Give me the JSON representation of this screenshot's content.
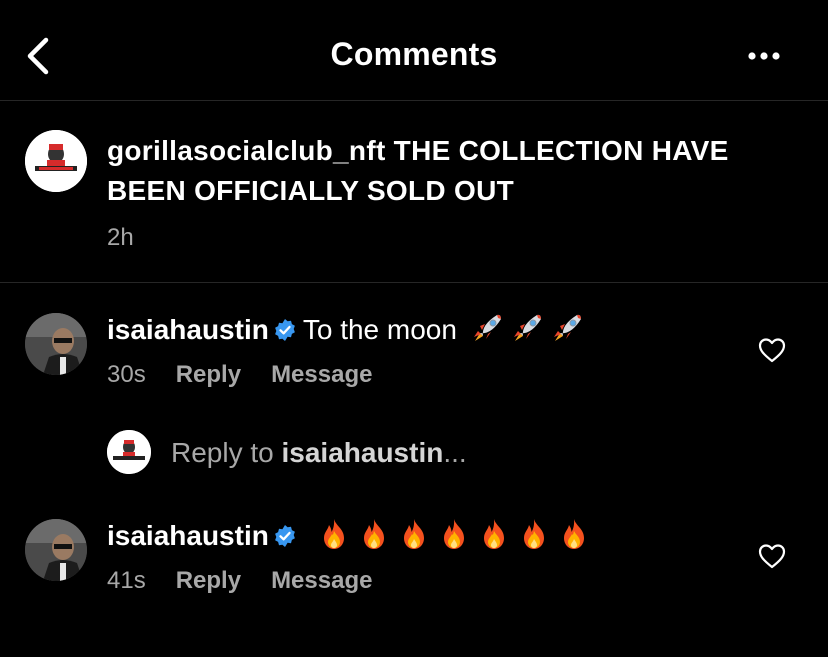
{
  "header": {
    "title": "Comments",
    "back_icon": "chevron-left-icon",
    "more_icon": "more-horizontal-icon"
  },
  "caption": {
    "username": "gorillasocialclub_nft",
    "text": "THE COLLECTION HAVE BEEN OFFICIALLY SOLD OUT",
    "time": "2h"
  },
  "comments": [
    {
      "username": "isaiahaustin",
      "text": "To the moon",
      "emojis": [
        "rocket",
        "rocket",
        "rocket"
      ],
      "time": "30s",
      "reply_label": "Reply",
      "message_label": "Message"
    },
    {
      "username": "isaiahaustin",
      "text": "",
      "emojis": [
        "fire",
        "fire",
        "fire",
        "fire",
        "fire",
        "fire",
        "fire"
      ],
      "time": "41s",
      "reply_label": "Reply",
      "message_label": "Message"
    }
  ],
  "reply_prompt": {
    "prefix": "Reply to ",
    "username": "isaiahaustin",
    "suffix": "..."
  },
  "colors": {
    "background": "#000000",
    "muted_text": "#a8a8a8",
    "verified_blue": "#3897f0",
    "divider": "#262626"
  }
}
